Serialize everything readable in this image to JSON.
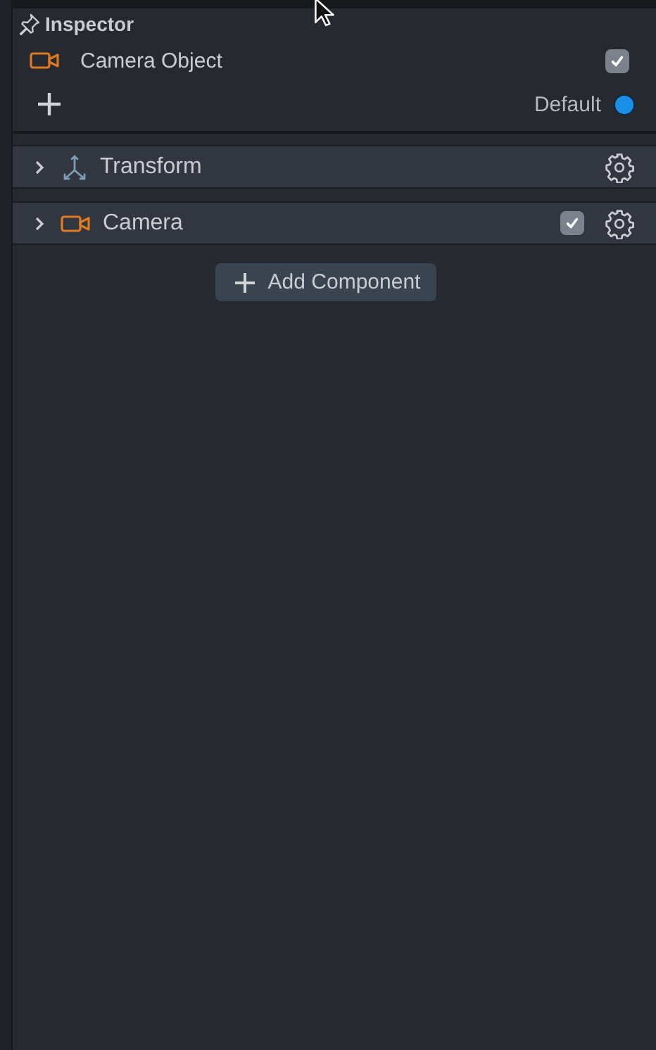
{
  "panel": {
    "title": "Inspector"
  },
  "object": {
    "name": "Camera Object",
    "enabled": true,
    "layer": "Default"
  },
  "components": [
    {
      "kind": "transform",
      "name": "Transform",
      "expanded": false
    },
    {
      "kind": "camera",
      "name": "Camera",
      "expanded": false,
      "enabled": true
    }
  ],
  "add_button": "Add Component"
}
